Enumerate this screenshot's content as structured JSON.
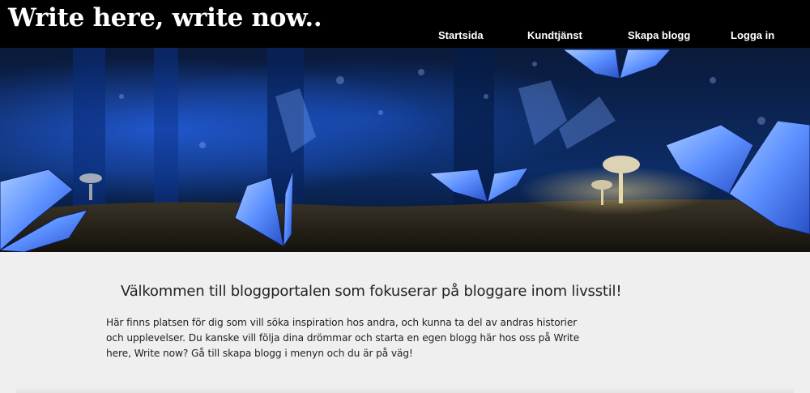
{
  "header": {
    "site_title": "Write here, write now.."
  },
  "nav": {
    "items": [
      {
        "label": "Startsida"
      },
      {
        "label": "Kundtjänst"
      },
      {
        "label": "Skapa blogg"
      },
      {
        "label": "Logga in"
      }
    ]
  },
  "hero": {
    "image": "blue-butterflies-forest-mushrooms"
  },
  "main": {
    "welcome_heading": "Välkommen till bloggportalen som fokuserar på bloggare inom livsstil!",
    "intro_text": "Här finns platsen för dig som vill söka inspiration hos andra, och kunna ta del av andras historier och upplevelser. Du kanske vill följa dina drömmar och starta en egen blogg här hos oss på Write here, Write now? Gå till skapa blogg i menyn och du är på väg!"
  },
  "colors": {
    "header_bg": "#000000",
    "page_bg": "#efefef",
    "butterfly_blue": "#6fa4ff"
  }
}
